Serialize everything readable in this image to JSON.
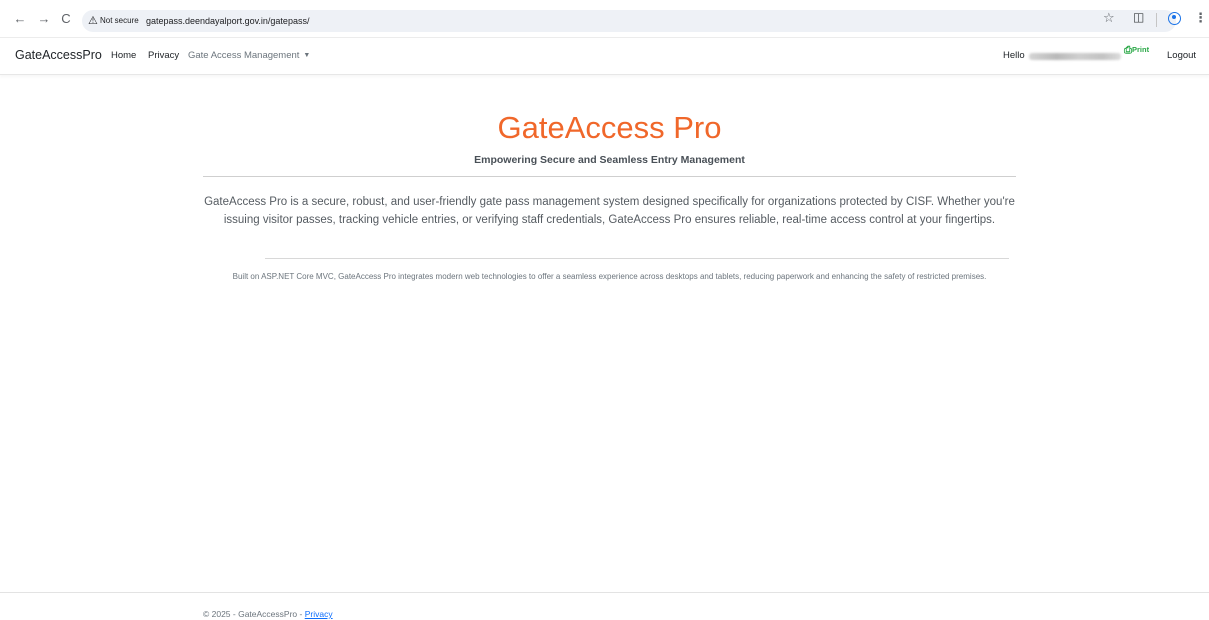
{
  "browser": {
    "back": "←",
    "forward": "→",
    "reload": "C",
    "security_label": "Not secure",
    "url": "gatepass.deendayalport.gov.in/gatepass/"
  },
  "navbar": {
    "brand": "GateAccessPro",
    "links": [
      "Home",
      "Privacy"
    ],
    "dropdown_label": "Gate Access Management",
    "hello": "Hello",
    "print": "Print",
    "logout": "Logout"
  },
  "main": {
    "title": "GateAccess Pro",
    "subtitle": "Empowering Secure and Seamless Entry Management",
    "lead": "GateAccess Pro is a secure, robust, and user-friendly gate pass management system designed specifically for organizations protected by CISF. Whether you're issuing visitor passes, tracking vehicle entries, or verifying staff credentials, GateAccess Pro ensures reliable, real-time access control at your fingertips.",
    "detail": "Built on ASP.NET Core MVC, GateAccess Pro integrates modern web technologies to offer a seamless experience across desktops and tablets, reducing paperwork and enhancing the safety of restricted premises."
  },
  "footer": {
    "copyright": "© 2025 - GateAccessPro -",
    "privacy_link": "Privacy"
  },
  "colors": {
    "accent": "#f0672a",
    "print": "#28a745",
    "link": "#0d6efd"
  },
  "icons": {
    "warning": "warning-triangle-icon",
    "star": "bookmark-star-icon",
    "extensions": "extensions-icon",
    "profile": "profile-icon",
    "menu": "more-vert-icon",
    "printer": "printer-icon"
  }
}
